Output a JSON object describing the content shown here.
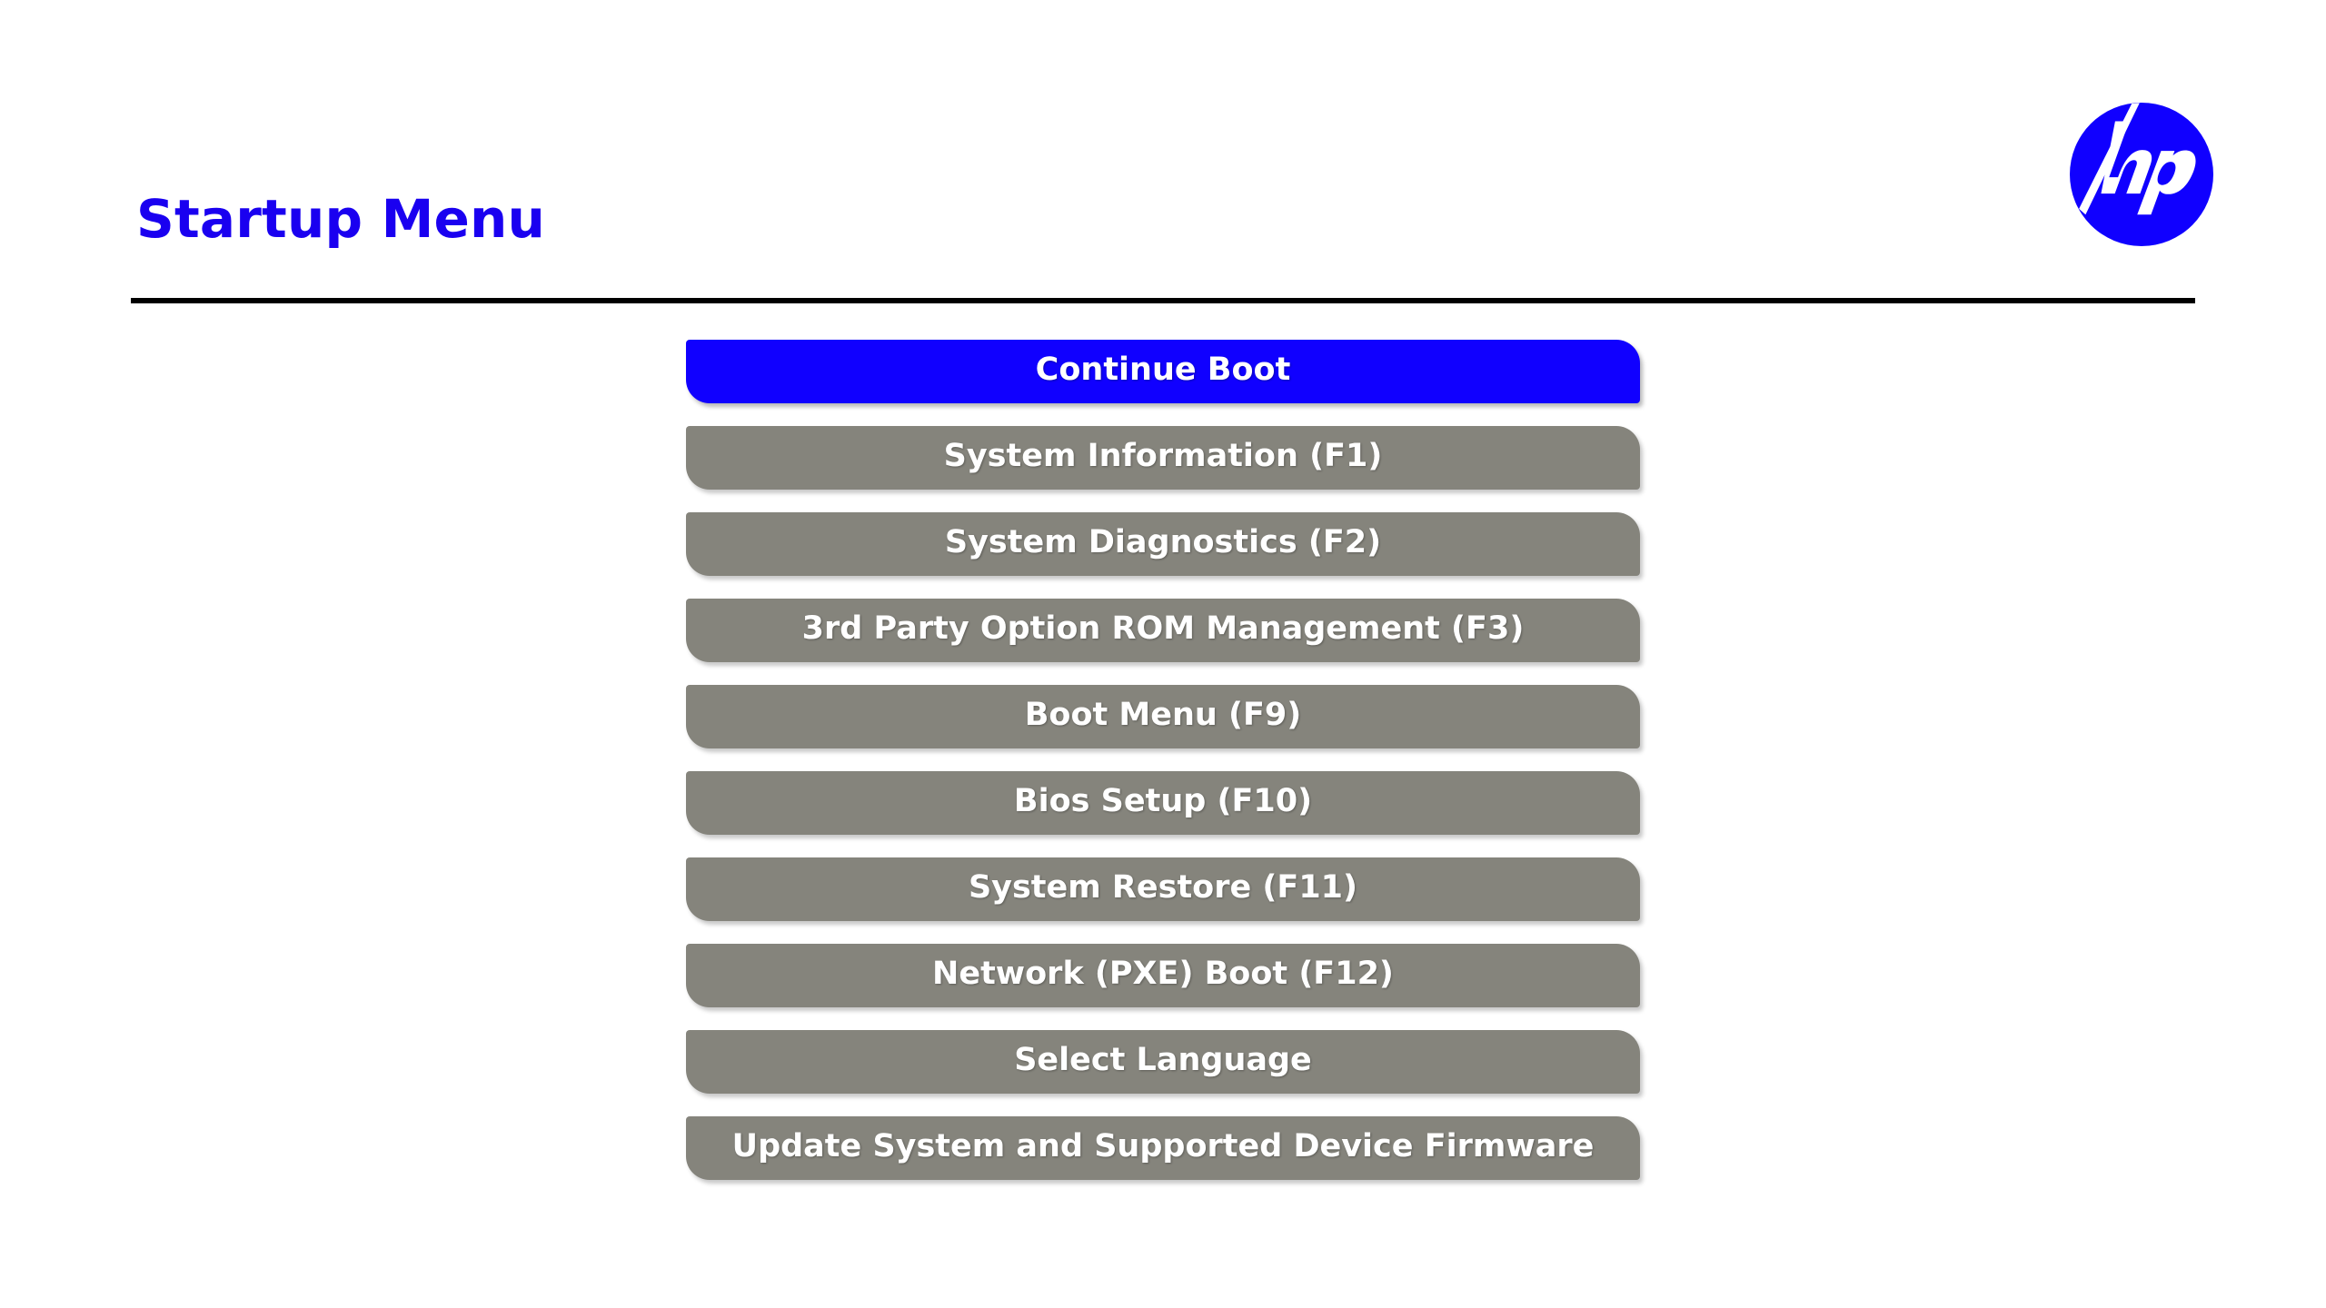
{
  "header": {
    "title": "Startup Menu",
    "title_color": "#1a00f0",
    "rule_color": "#000000",
    "logo_name": "hp-logo",
    "logo_color": "#1000ff"
  },
  "menu": {
    "selected_index": 0,
    "selected_color": "#1000ff",
    "item_color": "#85847c",
    "label_color": "#ffffff",
    "items": [
      {
        "label": "Continue Boot",
        "selected": true
      },
      {
        "label": "System Information (F1)",
        "selected": false
      },
      {
        "label": "System Diagnostics (F2)",
        "selected": false
      },
      {
        "label": "3rd Party Option ROM Management (F3)",
        "selected": false
      },
      {
        "label": "Boot Menu (F9)",
        "selected": false
      },
      {
        "label": "Bios Setup (F10)",
        "selected": false
      },
      {
        "label": "System Restore (F11)",
        "selected": false
      },
      {
        "label": "Network (PXE) Boot (F12)",
        "selected": false
      },
      {
        "label": "Select Language",
        "selected": false
      },
      {
        "label": "Update System and Supported Device Firmware",
        "selected": false
      }
    ]
  }
}
